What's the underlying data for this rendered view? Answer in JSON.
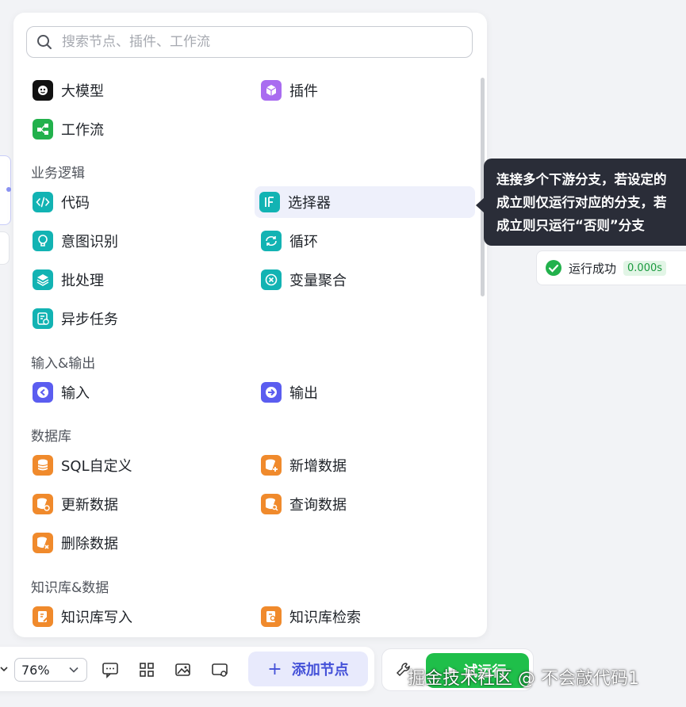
{
  "search": {
    "placeholder": "搜索节点、插件、工作流"
  },
  "top_items": [
    {
      "label": "大模型",
      "icon": "llm-icon"
    },
    {
      "label": "插件",
      "icon": "plugin-cube-icon"
    },
    {
      "label": "工作流",
      "icon": "workflow-icon"
    }
  ],
  "categories": [
    {
      "title": "业务逻辑",
      "items": [
        {
          "label": "代码",
          "icon": "code-icon"
        },
        {
          "label": "选择器",
          "icon": "if-selector-icon"
        },
        {
          "label": "意图识别",
          "icon": "intent-bulb-icon"
        },
        {
          "label": "循环",
          "icon": "loop-icon"
        },
        {
          "label": "批处理",
          "icon": "batch-layers-icon"
        },
        {
          "label": "变量聚合",
          "icon": "variable-aggregate-icon"
        },
        {
          "label": "异步任务",
          "icon": "async-task-icon"
        }
      ]
    },
    {
      "title": "输入&输出",
      "items": [
        {
          "label": "输入",
          "icon": "input-icon"
        },
        {
          "label": "输出",
          "icon": "output-icon"
        }
      ]
    },
    {
      "title": "数据库",
      "items": [
        {
          "label": "SQL自定义",
          "icon": "sql-db-icon"
        },
        {
          "label": "新增数据",
          "icon": "db-add-icon"
        },
        {
          "label": "更新数据",
          "icon": "db-update-icon"
        },
        {
          "label": "查询数据",
          "icon": "db-query-icon"
        },
        {
          "label": "删除数据",
          "icon": "db-delete-icon"
        }
      ]
    },
    {
      "title": "知识库&数据",
      "items": [
        {
          "label": "知识库写入",
          "icon": "kb-write-icon"
        },
        {
          "label": "知识库检索",
          "icon": "kb-search-icon"
        }
      ]
    }
  ],
  "tooltip": {
    "lines": [
      "连接多个下游分支，若设定的",
      "成立则仅运行对应的分支，若",
      "成立则只运行“否则”分支"
    ]
  },
  "run_status": {
    "text": "运行成功",
    "time": "0.000s"
  },
  "toolbar": {
    "zoom": "76%",
    "add_node": "添加节点",
    "test_run": "试运行"
  },
  "watermark": "掘金技术社区 @ 不会敲代码1",
  "colors": {
    "teal": "#12b3b3",
    "purple": "#a96cf0",
    "green": "#22b14c",
    "indigo": "#5b5df0",
    "orange": "#f08a2c",
    "accent": "#4451d8",
    "run_green": "#1fbf4a"
  }
}
